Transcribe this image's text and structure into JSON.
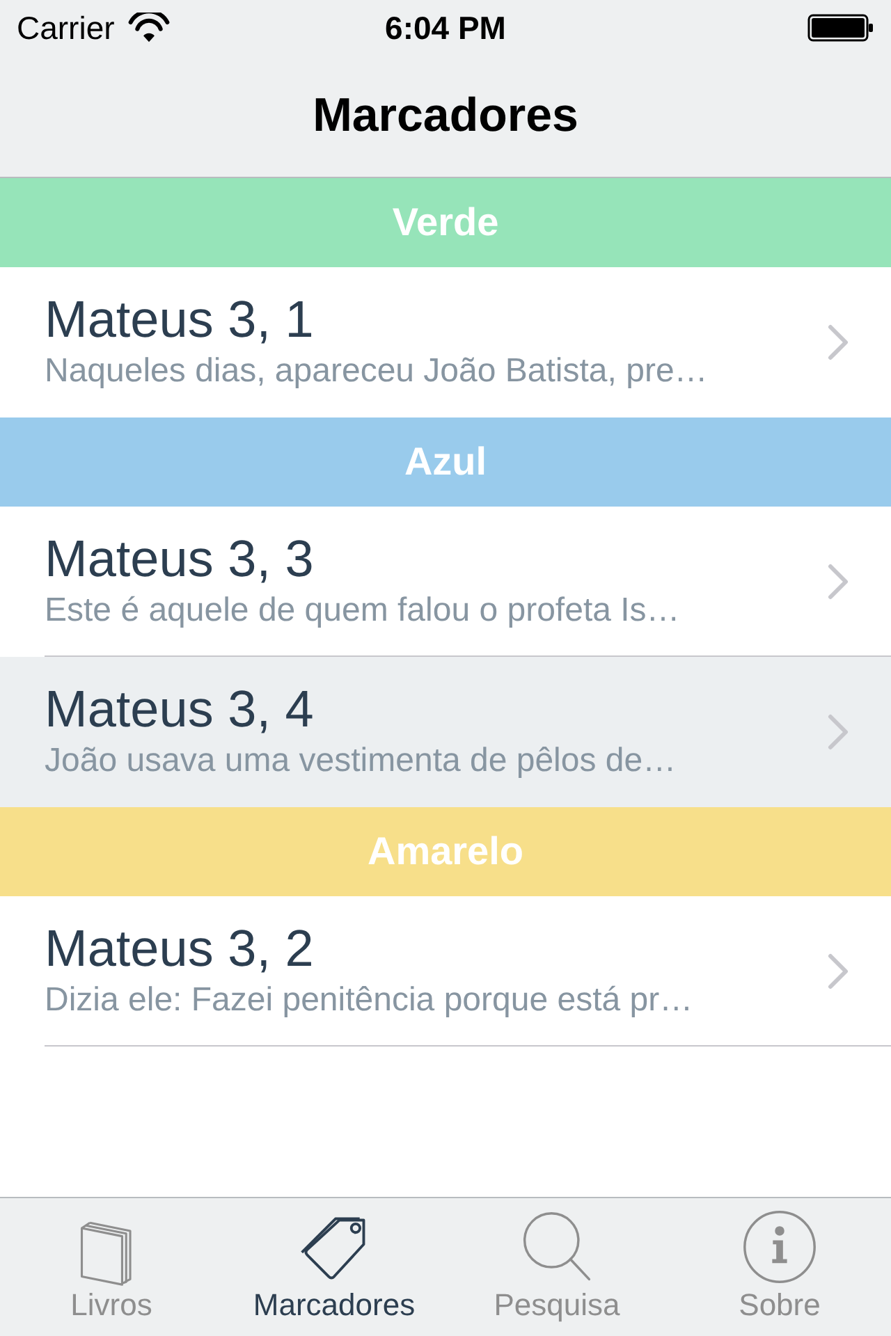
{
  "status_bar": {
    "carrier": "Carrier",
    "time": "6:04 PM"
  },
  "nav_bar": {
    "title": "Marcadores"
  },
  "sections": [
    {
      "title": "Verde",
      "color": "#96e4b9",
      "rows": [
        {
          "title": "Mateus 3, 1",
          "subtitle": "Naqueles dias, apareceu João Batista, pre…",
          "selected": false
        }
      ]
    },
    {
      "title": "Azul",
      "color": "#99cbec",
      "rows": [
        {
          "title": "Mateus 3, 3",
          "subtitle": "Este é aquele de quem falou o profeta Is…",
          "selected": false
        },
        {
          "title": "Mateus 3, 4",
          "subtitle": "João usava uma vestimenta de pêlos de…",
          "selected": true
        }
      ]
    },
    {
      "title": "Amarelo",
      "color": "#f7df8a",
      "rows": [
        {
          "title": "Mateus 3, 2",
          "subtitle": "Dizia ele: Fazei penitência porque está pr…",
          "selected": false
        }
      ]
    }
  ],
  "tab_bar": {
    "tabs": [
      {
        "kind": "books",
        "label": "Livros",
        "selected": false
      },
      {
        "kind": "tags",
        "label": "Marcadores",
        "selected": true
      },
      {
        "kind": "search",
        "label": "Pesquisa",
        "selected": false
      },
      {
        "kind": "info",
        "label": "Sobre",
        "selected": false
      }
    ]
  }
}
